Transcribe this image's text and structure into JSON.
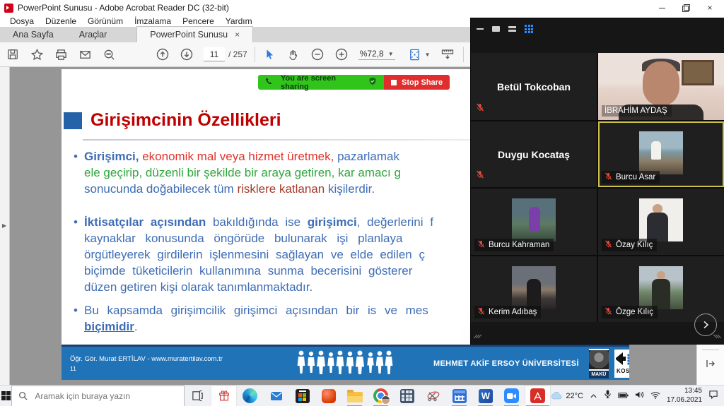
{
  "window": {
    "title": "PowerPoint Sunusu - Adobe Acrobat Reader DC (32-bit)"
  },
  "menu": {
    "items": [
      "Dosya",
      "Düzenle",
      "Görünüm",
      "İmzalama",
      "Pencere",
      "Yardım"
    ]
  },
  "tabs": {
    "home": "Ana Sayfa",
    "tools": "Araçlar",
    "doc": "PowerPoint Sunusu",
    "close_glyph": "×"
  },
  "toolbar": {
    "page_current": "11",
    "page_total": "/ 257",
    "zoom_level": "%72,8"
  },
  "share": {
    "banner": "You are screen sharing",
    "stop": "Stop Share"
  },
  "slide": {
    "bullet": "•",
    "title": "Girişimcinin Özellikleri",
    "p1l1r1": "Girişimci,",
    "p1l1r2": " ekonomik mal veya hizmet üretmek,",
    "p1l1r3": " pazarlamak",
    "p1l2r1": "ele geçirip, düzenli bir şekilde bir araya getiren,",
    "p1l2r2": " kar amacı g",
    "p1l3r1": "sonucunda doğabilecek tüm ",
    "p1l3r2": "risklere katlanan ",
    "p1l3r3": "kişilerdir.",
    "p2l1r1": "İktisatçılar açısından",
    "p2l1r2": " bakıldığında ise ",
    "p2l1r3": "girişimci",
    "p2l1r4": ", değerlerini f",
    "p2l2": "kaynaklar konusunda öngörüde bulunarak işi planlaya",
    "p2l3": "örgütleyerek girdilerin işlenmesini sağlayan ve elde edilen ç",
    "p2l4": "biçimde tüketicilerin kullanımına sunma becerisini gösterer",
    "p2l5": "düzen getiren kişi olarak tanımlanmaktadır.",
    "p3l1": "Bu kapsamda girişimcilik girişimci açısından bir is ve mes",
    "p3l2r1": "biçimidir",
    "p3l2r2": ".",
    "footer": {
      "author": "Öğr. Gör. Murat ERTİLAV  -  www.muratertilav.com.tr",
      "page": "11",
      "university": "MEHMET AKİF ERSOY ÜNİVERSİTESİ",
      "maku": "MAKÜ",
      "kosgeb": "KOSGEB"
    }
  },
  "zoom": {
    "participants": [
      {
        "name": "Betül Tokcoban"
      },
      {
        "name": "İBRAHİM AYDAŞ"
      },
      {
        "name": "Duygu Kocataş"
      },
      {
        "name": "Burcu Asar"
      },
      {
        "name": "Burcu Kahraman"
      },
      {
        "name": "Özay Kılıç"
      },
      {
        "name": "Kerim Adıbaş"
      },
      {
        "name": "Özge Kılıç"
      }
    ]
  },
  "taskbar": {
    "search_placeholder": "Aramak için buraya yazın",
    "word_letter": "W",
    "weather": "22°C",
    "clock_time": "13:45",
    "clock_date": "17.06.2021"
  },
  "colors": {
    "title_red": "#C00000",
    "body_blue": "#3E6DB5",
    "run_red": "#E0342C",
    "run_dark_red": "#A43B2C",
    "run_green": "#2FA63C",
    "footer_blue": "#2173B8",
    "footer_navy": "#17365D",
    "share_green": "#31C51B",
    "stop_red": "#E02D2D",
    "active_tile_yellow": "#CFC14E",
    "zoom_grid_blue": "#2D8CFF",
    "taskbar_underline": "#58B2D6"
  }
}
